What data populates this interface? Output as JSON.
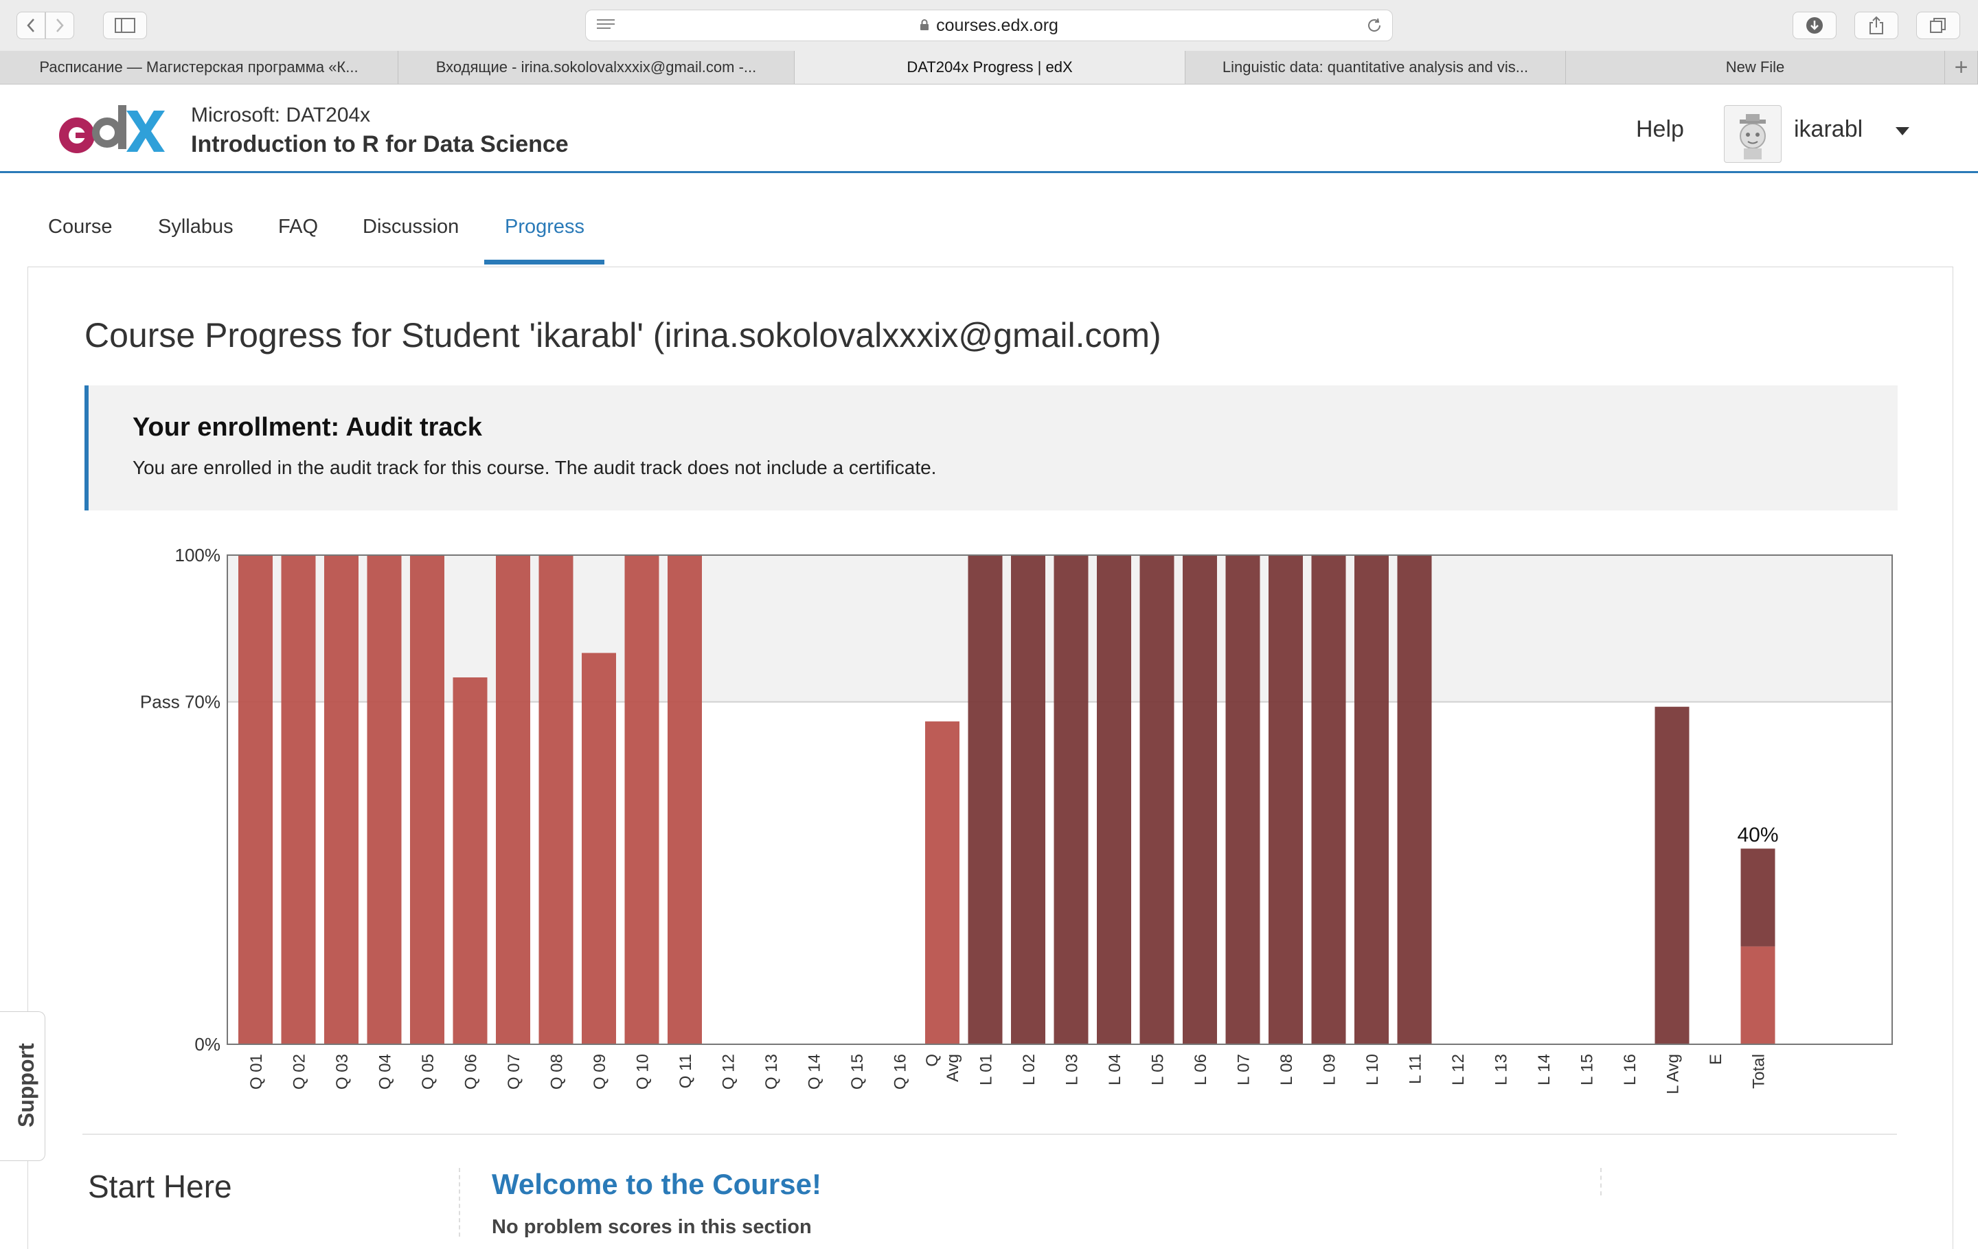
{
  "browser": {
    "url": "courses.edx.org",
    "tabs": [
      {
        "label": "Расписание — Магистерская программа «К...",
        "active": false
      },
      {
        "label": "Входящие - irina.sokolovalxxxix@gmail.com -...",
        "active": false
      },
      {
        "label": "DAT204x Progress | edX",
        "active": true
      },
      {
        "label": "Linguistic data: quantitative analysis and vis...",
        "active": false
      },
      {
        "label": "New File",
        "active": false
      }
    ],
    "add_tab": "+"
  },
  "header": {
    "org": "Microsoft: DAT204x",
    "course_name": "Introduction to R for Data Science",
    "help": "Help",
    "username": "ikarabl"
  },
  "course_nav": [
    {
      "label": "Course",
      "active": false
    },
    {
      "label": "Syllabus",
      "active": false
    },
    {
      "label": "FAQ",
      "active": false
    },
    {
      "label": "Discussion",
      "active": false
    },
    {
      "label": "Progress",
      "active": true
    }
  ],
  "main": {
    "title": "Course Progress for Student 'ikarabl' (irina.sokolovalxxxix@gmail.com)",
    "enrollment_heading": "Your enrollment: Audit track",
    "enrollment_text": "You are enrolled in the audit track for this course. The audit track does not include a certificate."
  },
  "colors": {
    "accent": "#2a7ab8",
    "quiz_bar": "#b9534d",
    "lab_bar": "#7a3a3a",
    "pass_band": "#f2f2f2"
  },
  "chart_data": {
    "type": "bar",
    "ylim": [
      0,
      100
    ],
    "pass_line": 70,
    "y_ticks": [
      {
        "value": 100,
        "label": "100%"
      },
      {
        "value": 70,
        "label": "Pass 70%"
      },
      {
        "value": 0,
        "label": "0%"
      }
    ],
    "categories": [
      "Q 01",
      "Q 02",
      "Q 03",
      "Q 04",
      "Q 05",
      "Q 06",
      "Q 07",
      "Q 08",
      "Q 09",
      "Q 10",
      "Q 11",
      "Q 12",
      "Q 13",
      "Q 14",
      "Q 15",
      "Q 16",
      "Q Avg",
      "L 01",
      "L 02",
      "L 03",
      "L 04",
      "L 05",
      "L 06",
      "L 07",
      "L 08",
      "L 09",
      "L 10",
      "L 11",
      "L 12",
      "L 13",
      "L 14",
      "L 15",
      "L 16",
      "L Avg",
      "E",
      "Total"
    ],
    "series": [
      {
        "values": [
          100,
          100,
          100,
          100,
          100,
          75,
          100,
          100,
          80,
          100,
          100,
          0,
          0,
          0,
          0,
          0,
          66,
          0,
          0,
          0,
          0,
          0,
          0,
          0,
          0,
          0,
          0,
          0,
          0,
          0,
          0,
          0,
          0,
          0,
          0,
          20
        ],
        "color": "#b9534d"
      },
      {
        "values": [
          0,
          0,
          0,
          0,
          0,
          0,
          0,
          0,
          0,
          0,
          0,
          0,
          0,
          0,
          0,
          0,
          0,
          100,
          100,
          100,
          100,
          100,
          100,
          100,
          100,
          100,
          100,
          100,
          0,
          0,
          0,
          0,
          0,
          69,
          0,
          20
        ],
        "color": "#7a3a3a"
      }
    ],
    "total_label": "40%"
  },
  "sections": {
    "left_title": "Start Here",
    "welcome": "Welcome to the Course!",
    "no_scores": "No problem scores in this section"
  },
  "support_label": "Support"
}
